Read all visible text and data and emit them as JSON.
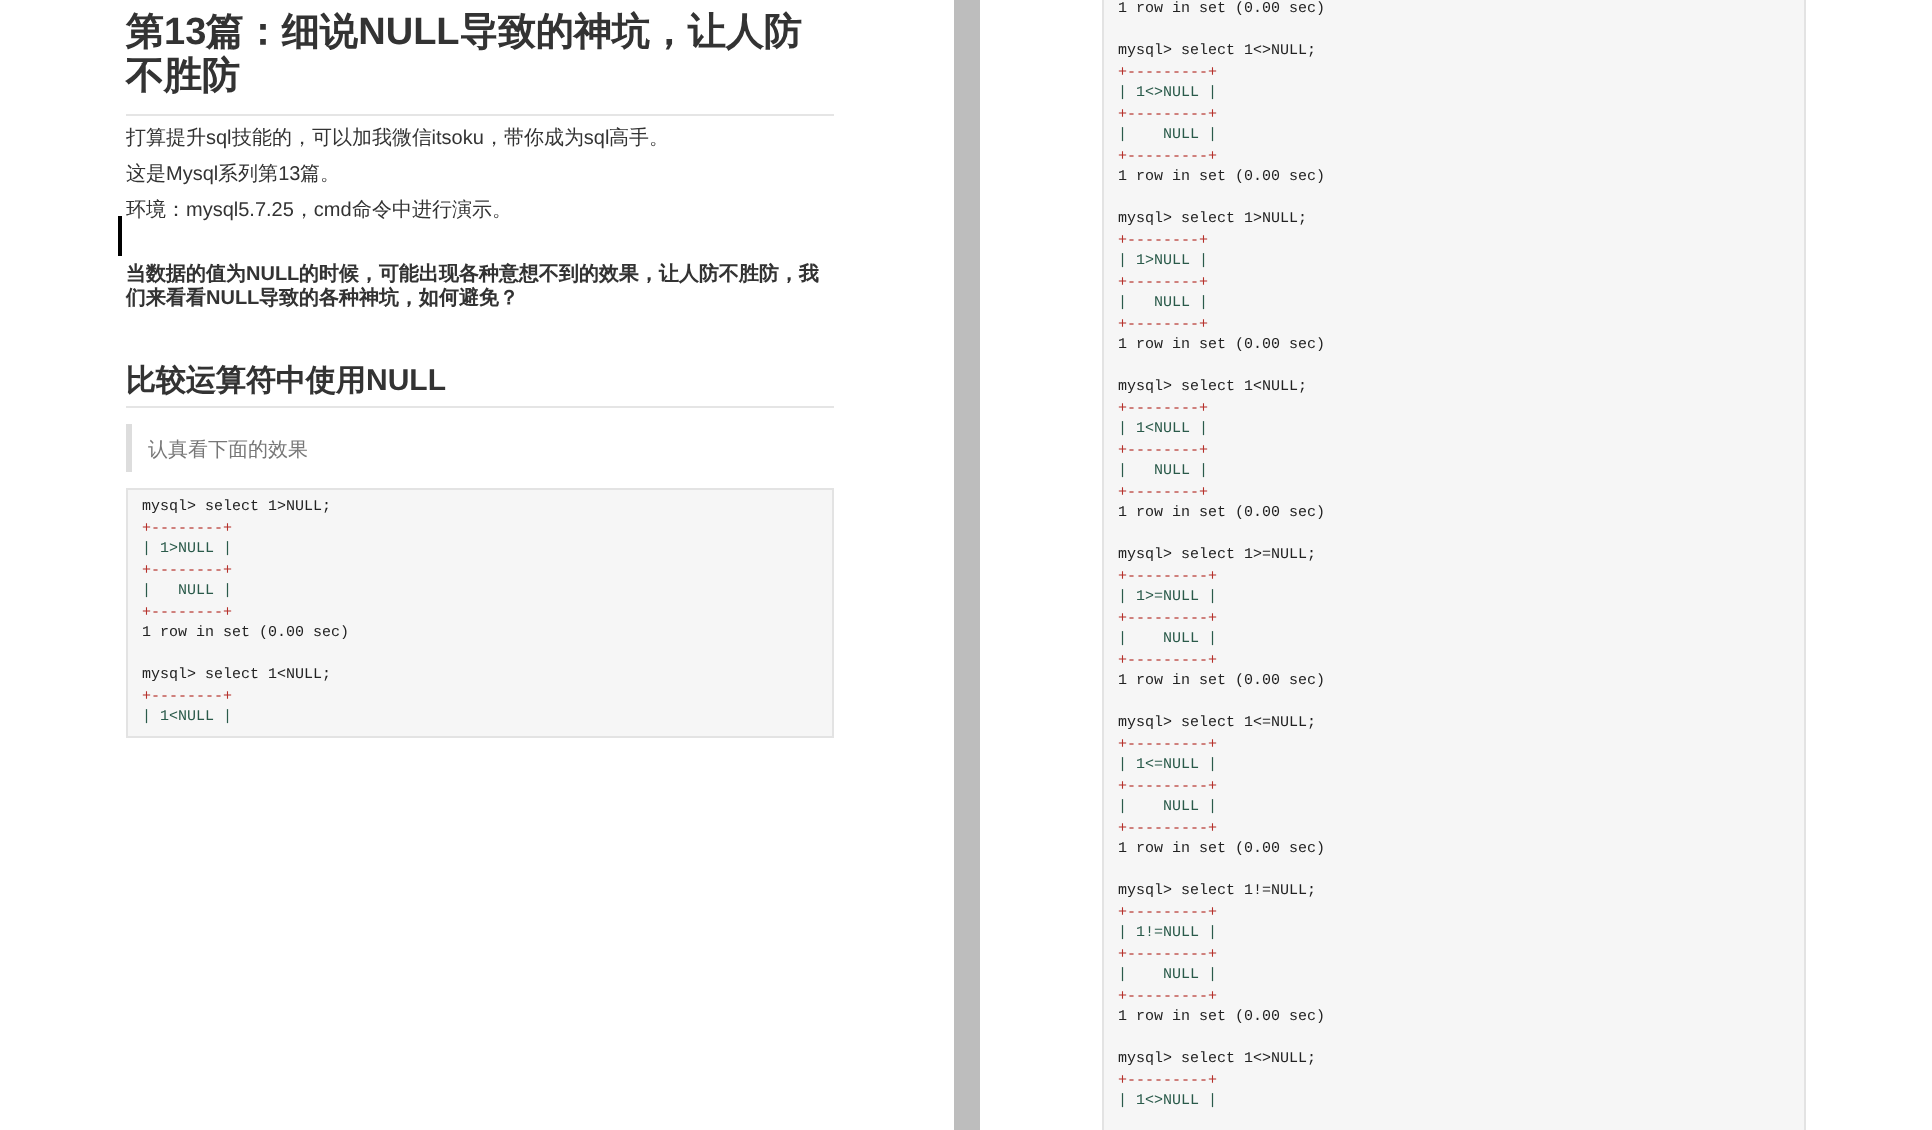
{
  "left_page": {
    "title": "第13篇：细说NULL导致的神坑，让人防不胜防",
    "paragraphs": [
      "打算提升sql技能的，可以加我微信itsoku，带你成为sql高手。",
      "这是Mysql系列第13篇。",
      "环境：mysql5.7.25，cmd命令中进行演示。"
    ],
    "intro": "当数据的值为NULL的时候，可能出现各种意想不到的效果，让人防不胜防，我们来看看NULL导致的各种神坑，如何避免？",
    "heading": "比较运算符中使用NULL",
    "quote": "认真看下面的效果",
    "code_blocks": [
      {
        "lines": [
          {
            "kind": "prompt",
            "text": "mysql> select 1>NULL;"
          },
          {
            "kind": "border",
            "text": "+--------+"
          },
          {
            "kind": "row",
            "text": "| 1>NULL |"
          },
          {
            "kind": "border",
            "text": "+--------+"
          },
          {
            "kind": "row",
            "text": "|   NULL |"
          },
          {
            "kind": "border",
            "text": "+--------+"
          },
          {
            "kind": "result",
            "text": "1 row in set (0.00 sec)"
          }
        ]
      },
      {
        "lines": [
          {
            "kind": "prompt",
            "text": "mysql> select 1<NULL;"
          },
          {
            "kind": "border",
            "text": "+--------+"
          },
          {
            "kind": "row",
            "text": "| 1<NULL |"
          }
        ]
      }
    ]
  },
  "right_page": {
    "code_blocks": [
      {
        "lines": [
          {
            "kind": "result",
            "text": "1 row in set (0.00 sec)"
          }
        ]
      },
      {
        "lines": [
          {
            "kind": "prompt",
            "text": "mysql> select 1<>NULL;"
          },
          {
            "kind": "border",
            "text": "+---------+"
          },
          {
            "kind": "row",
            "text": "| 1<>NULL |"
          },
          {
            "kind": "border",
            "text": "+---------+"
          },
          {
            "kind": "row",
            "text": "|    NULL |"
          },
          {
            "kind": "border",
            "text": "+---------+"
          },
          {
            "kind": "result",
            "text": "1 row in set (0.00 sec)"
          }
        ]
      },
      {
        "lines": [
          {
            "kind": "prompt",
            "text": "mysql> select 1>NULL;"
          },
          {
            "kind": "border",
            "text": "+--------+"
          },
          {
            "kind": "row",
            "text": "| 1>NULL |"
          },
          {
            "kind": "border",
            "text": "+--------+"
          },
          {
            "kind": "row",
            "text": "|   NULL |"
          },
          {
            "kind": "border",
            "text": "+--------+"
          },
          {
            "kind": "result",
            "text": "1 row in set (0.00 sec)"
          }
        ]
      },
      {
        "lines": [
          {
            "kind": "prompt",
            "text": "mysql> select 1<NULL;"
          },
          {
            "kind": "border",
            "text": "+--------+"
          },
          {
            "kind": "row",
            "text": "| 1<NULL |"
          },
          {
            "kind": "border",
            "text": "+--------+"
          },
          {
            "kind": "row",
            "text": "|   NULL |"
          },
          {
            "kind": "border",
            "text": "+--------+"
          },
          {
            "kind": "result",
            "text": "1 row in set (0.00 sec)"
          }
        ]
      },
      {
        "lines": [
          {
            "kind": "prompt",
            "text": "mysql> select 1>=NULL;"
          },
          {
            "kind": "border",
            "text": "+---------+"
          },
          {
            "kind": "row",
            "text": "| 1>=NULL |"
          },
          {
            "kind": "border",
            "text": "+---------+"
          },
          {
            "kind": "row",
            "text": "|    NULL |"
          },
          {
            "kind": "border",
            "text": "+---------+"
          },
          {
            "kind": "result",
            "text": "1 row in set (0.00 sec)"
          }
        ]
      },
      {
        "lines": [
          {
            "kind": "prompt",
            "text": "mysql> select 1<=NULL;"
          },
          {
            "kind": "border",
            "text": "+---------+"
          },
          {
            "kind": "row",
            "text": "| 1<=NULL |"
          },
          {
            "kind": "border",
            "text": "+---------+"
          },
          {
            "kind": "row",
            "text": "|    NULL |"
          },
          {
            "kind": "border",
            "text": "+---------+"
          },
          {
            "kind": "result",
            "text": "1 row in set (0.00 sec)"
          }
        ]
      },
      {
        "lines": [
          {
            "kind": "prompt",
            "text": "mysql> select 1!=NULL;"
          },
          {
            "kind": "border",
            "text": "+---------+"
          },
          {
            "kind": "row",
            "text": "| 1!=NULL |"
          },
          {
            "kind": "border",
            "text": "+---------+"
          },
          {
            "kind": "row",
            "text": "|    NULL |"
          },
          {
            "kind": "border",
            "text": "+---------+"
          },
          {
            "kind": "result",
            "text": "1 row in set (0.00 sec)"
          }
        ]
      },
      {
        "lines": [
          {
            "kind": "prompt",
            "text": "mysql> select 1<>NULL;"
          },
          {
            "kind": "border",
            "text": "+---------+"
          },
          {
            "kind": "row",
            "text": "| 1<>NULL |"
          }
        ]
      }
    ]
  }
}
